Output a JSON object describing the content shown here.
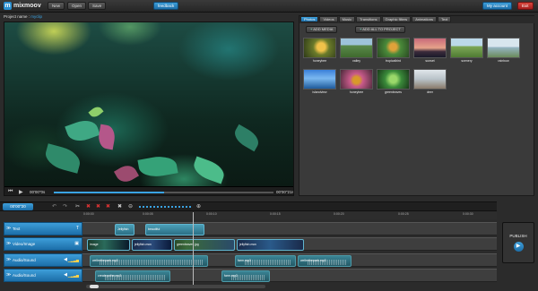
{
  "app": {
    "logo_text": "mixmoov"
  },
  "topbar": {
    "buttons": [
      {
        "label": "New"
      },
      {
        "label": "Open"
      },
      {
        "label": "Save"
      }
    ],
    "feedback": "feedback",
    "my_account": "My account",
    "exit": "Exit"
  },
  "project": {
    "label": "Project name :",
    "name": "myclip"
  },
  "player": {
    "time_current": "00'00\"0s",
    "time_total": "00'00\"21s"
  },
  "media": {
    "tabs": [
      {
        "label": "Photos",
        "active": true
      },
      {
        "label": "Videos"
      },
      {
        "label": "Music"
      },
      {
        "label": "Transitions"
      },
      {
        "label": "Graphic filters"
      },
      {
        "label": "Animations"
      },
      {
        "label": "Text"
      }
    ],
    "add_media": "ADD MEDIA",
    "add_all": "ADD ALL TO PROJECT",
    "items": [
      {
        "caption": "honeybee"
      },
      {
        "caption": "valley"
      },
      {
        "caption": "tropicalbird"
      },
      {
        "caption": "sunset"
      },
      {
        "caption": "scenery"
      },
      {
        "caption": "rainbow"
      },
      {
        "caption": "islandview"
      },
      {
        "caption": "honeybee"
      },
      {
        "caption": "greenleaves"
      },
      {
        "caption": "deer"
      }
    ]
  },
  "timeline": {
    "timecode": "00'00\"20",
    "ruler": [
      "0:00:00",
      "0:00:05",
      "0:00:10",
      "0:00:15",
      "0:00:20",
      "0:00:25",
      "0:00:30"
    ],
    "tracks": [
      {
        "label": "Text",
        "clips": [
          {
            "label": "Jellyfish"
          },
          {
            "label": "beautiful"
          }
        ]
      },
      {
        "label": "Video/Image",
        "clips": [
          {
            "label": "image"
          },
          {
            "label": "jellyfish.mov"
          },
          {
            "label": "greenleaves.jpg"
          },
          {
            "label": "jellyfish.mov"
          }
        ]
      },
      {
        "label": "Audio/Sound",
        "clips": [
          {
            "label": "wellerthepark.mp3"
          },
          {
            "label": "farm.mp3"
          },
          {
            "label": "wellerthepark.mp3"
          }
        ]
      },
      {
        "label": "Audio/Sound",
        "clips": [
          {
            "label": "createpothe.mp3"
          },
          {
            "label": "farm.mp3"
          }
        ]
      }
    ],
    "publish": "PUBLISH"
  }
}
